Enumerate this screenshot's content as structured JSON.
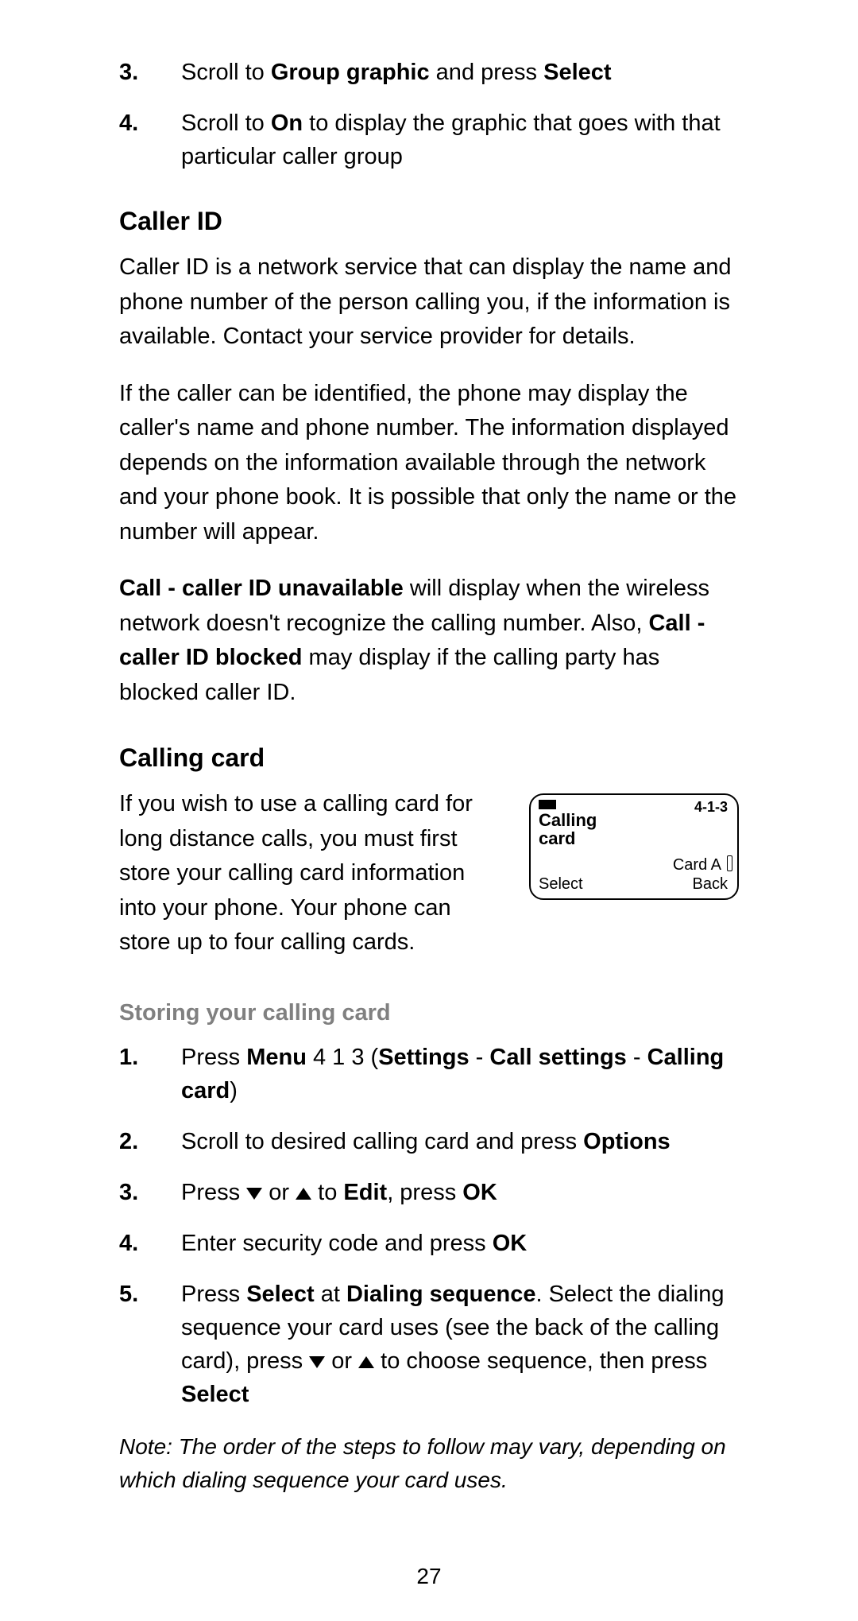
{
  "top_steps": [
    {
      "num": "3.",
      "parts": [
        "Scroll to ",
        {
          "b": "Group graphic"
        },
        " and press ",
        {
          "b": "Select"
        }
      ]
    },
    {
      "num": "4.",
      "parts": [
        "Scroll to ",
        {
          "b": "On"
        },
        " to display the graphic that goes with that particular caller group"
      ]
    }
  ],
  "caller_id": {
    "heading": "Caller ID",
    "p1": "Caller ID is a network service that can display the name and phone number of the person calling you, if the information is available. Contact your service provider for details.",
    "p2": "If the caller can be identified, the phone may display the caller's name and phone number. The information displayed depends on the information available through the network and your phone book. It is possible that only the name or the number will appear.",
    "p3_parts": [
      {
        "b": "Call - caller ID unavailable"
      },
      " will display when the wireless network doesn't recognize the calling number. Also, ",
      {
        "b": "Call - caller ID blocked"
      },
      " may display if the calling party has blocked caller ID."
    ]
  },
  "calling_card": {
    "heading": "Calling card",
    "intro": "If you wish to use a calling card for long distance calls, you must first store your calling card information into your phone. Your phone can store up to four calling cards.",
    "screen": {
      "code": "4-1-3",
      "title_line1": "Calling",
      "title_line2": "card",
      "card": "Card A",
      "select": "Select",
      "back": "Back"
    },
    "sub_heading": "Storing your calling card",
    "steps": [
      {
        "num": "1.",
        "parts": [
          "Press ",
          {
            "b": "Menu"
          },
          " 4 1 3 (",
          {
            "b": "Settings"
          },
          " - ",
          {
            "b": "Call settings"
          },
          " - ",
          {
            "b": "Calling card"
          },
          ")"
        ]
      },
      {
        "num": "2.",
        "parts": [
          "Scroll to desired calling card and press ",
          {
            "b": "Options"
          }
        ]
      },
      {
        "num": "3.",
        "parts": [
          "Press ",
          {
            "tri": "down"
          },
          " or ",
          {
            "tri": "up"
          },
          " to ",
          {
            "b": "Edit"
          },
          ", press ",
          {
            "b": "OK"
          }
        ]
      },
      {
        "num": "4.",
        "parts": [
          "Enter security code and press ",
          {
            "b": "OK"
          }
        ]
      },
      {
        "num": "5.",
        "parts": [
          "Press ",
          {
            "b": "Select"
          },
          " at ",
          {
            "b": "Dialing sequence"
          },
          ". Select the dialing sequence your card uses (see the back of the calling card), press ",
          {
            "tri": "down"
          },
          " or ",
          {
            "tri": "up"
          },
          " to choose sequence, then press ",
          {
            "b": "Select"
          }
        ]
      }
    ],
    "note": "Note: The order of the steps to follow may vary, depending on which dialing sequence your card uses."
  },
  "page_number": "27"
}
